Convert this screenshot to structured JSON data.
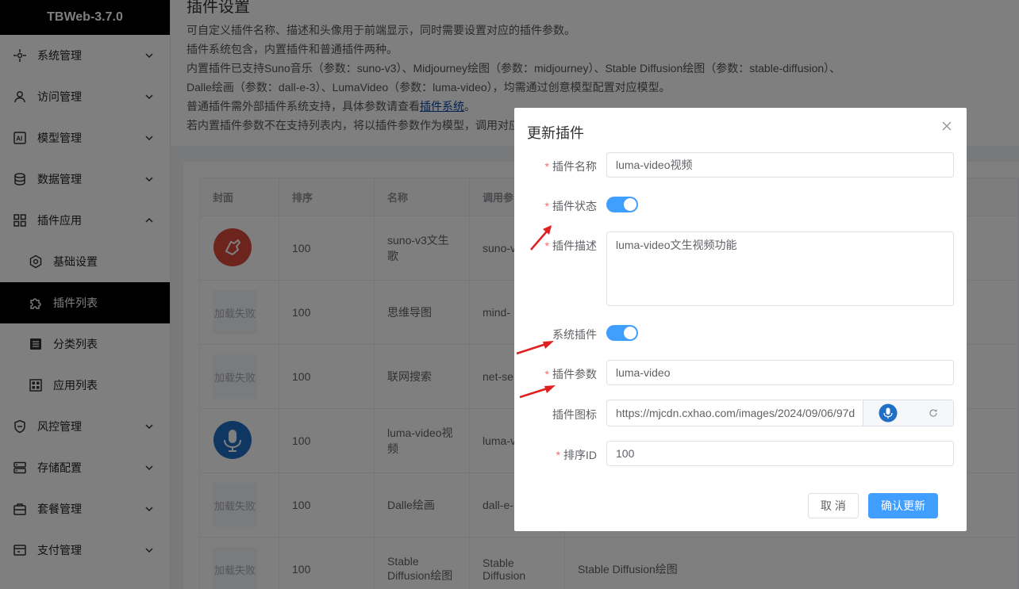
{
  "app": {
    "title": "TBWeb-3.7.0"
  },
  "sidebar": {
    "items": [
      {
        "label": "系统管理",
        "icon": "system-icon",
        "expanded": false
      },
      {
        "label": "访问管理",
        "icon": "user-icon",
        "expanded": false
      },
      {
        "label": "模型管理",
        "icon": "ai-model-icon",
        "expanded": false
      },
      {
        "label": "数据管理",
        "icon": "database-icon",
        "expanded": false
      },
      {
        "label": "插件应用",
        "icon": "grid-icon",
        "expanded": true
      },
      {
        "label": "基础设置",
        "icon": "settings-icon",
        "sub": true
      },
      {
        "label": "插件列表",
        "icon": "puzzle-icon",
        "sub": true,
        "active": true
      },
      {
        "label": "分类列表",
        "icon": "list-icon",
        "sub": true
      },
      {
        "label": "应用列表",
        "icon": "apps-icon",
        "sub": true
      },
      {
        "label": "风控管理",
        "icon": "shield-icon",
        "expanded": false
      },
      {
        "label": "存储配置",
        "icon": "storage-icon",
        "expanded": false
      },
      {
        "label": "套餐管理",
        "icon": "package-icon",
        "expanded": false
      },
      {
        "label": "支付管理",
        "icon": "payment-icon",
        "expanded": false
      }
    ]
  },
  "description": {
    "title": "插件设置",
    "lines": [
      "可自定义插件名称、描述和头像用于前端显示，同时需要设置对应的插件参数。",
      "插件系统包含，内置插件和普通插件两种。",
      "内置插件已支持Suno音乐（参数：suno-v3）、Midjourney绘图（参数：midjourney）、Stable Diffusion绘图（参数：stable-diffusion）、",
      "Dalle绘画（参数：dall-e-3）、LumaVideo（参数：luma-video），均需通过创意模型配置对应模型。",
      "普通插件需外部插件系统支持，具体参数请查看",
      "若内置插件参数不在支持列表内，将以插件参数作为模型，调用对应"
    ],
    "link_text": "插件系统",
    "link_suffix": "。"
  },
  "table": {
    "headers": [
      "封面",
      "排序",
      "名称",
      "调用参"
    ],
    "load_fail_text": "加载失败",
    "rows": [
      {
        "cover": "suno",
        "order": "100",
        "name": "suno-v3文生歌",
        "param": "suno-v"
      },
      {
        "cover": "fail",
        "order": "100",
        "name": "思维导图",
        "param": "mind-"
      },
      {
        "cover": "fail",
        "order": "100",
        "name": "联网搜索",
        "param": "net-se"
      },
      {
        "cover": "mic",
        "order": "100",
        "name": "luma-video视频",
        "param": "luma-v"
      },
      {
        "cover": "fail",
        "order": "100",
        "name": "Dalle绘画",
        "param": "dall-e-"
      },
      {
        "cover": "fail",
        "order": "100",
        "name": "Stable Diffusion绘图",
        "param": "Stable Diffusion",
        "desc": "Stable Diffusion绘图"
      }
    ]
  },
  "dialog": {
    "title": "更新插件",
    "fields": {
      "name_label": "插件名称",
      "name_value": "luma-video视频",
      "status_label": "插件状态",
      "desc_label": "插件描述",
      "desc_value": "luma-video文生视频功能",
      "system_label": "系统插件",
      "param_label": "插件参数",
      "param_value": "luma-video",
      "icon_label": "插件图标",
      "icon_value": "https://mjcdn.cxhao.com/images/2024/09/06/97d",
      "order_label": "排序ID",
      "order_value": "100"
    },
    "status_on": true,
    "system_on": true,
    "cancel_label": "取 消",
    "confirm_label": "确认更新"
  },
  "colors": {
    "primary": "#409eff",
    "required": "#f56c6c",
    "annotation": "#e02020",
    "sidebar_active": "#000000"
  }
}
